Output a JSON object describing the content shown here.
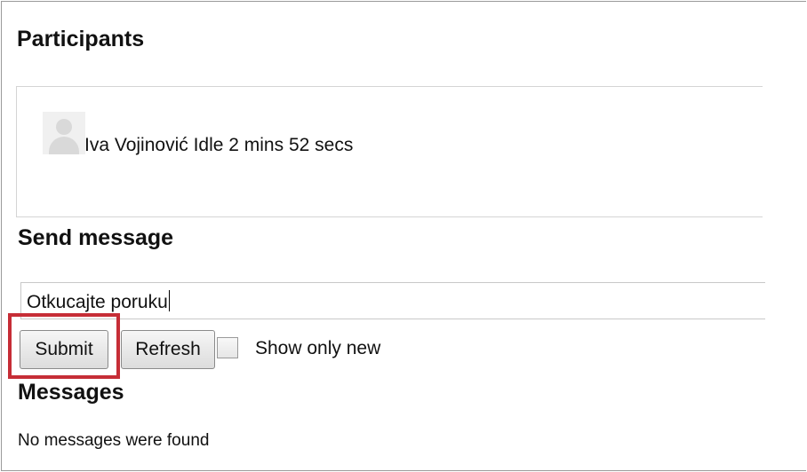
{
  "participants": {
    "heading": "Participants",
    "items": [
      {
        "name": "Iva Vojinović",
        "status": "Idle 2 mins 52 secs",
        "display": "Iva Vojinović Idle 2 mins 52 secs"
      }
    ]
  },
  "send": {
    "heading": "Send message",
    "input_value": "Otkucajte poruku",
    "submit_label": "Submit",
    "refresh_label": "Refresh",
    "show_only_new_label": "Show only new",
    "show_only_new_checked": false
  },
  "messages": {
    "heading": "Messages",
    "empty_text": "No messages were found"
  },
  "colors": {
    "highlight": "#c62d36"
  }
}
